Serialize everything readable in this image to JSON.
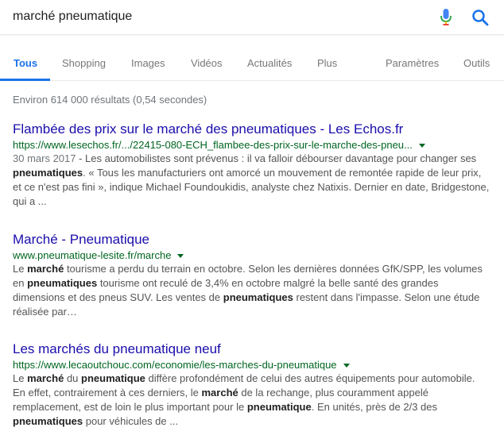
{
  "search": {
    "query": "marché pneumatique",
    "icons": {
      "mic": "mic-icon",
      "search": "search-icon"
    }
  },
  "tabs": [
    {
      "label": "Tous",
      "active": true
    },
    {
      "label": "Shopping"
    },
    {
      "label": "Images"
    },
    {
      "label": "Vidéos"
    },
    {
      "label": "Actualités"
    },
    {
      "label": "Plus"
    },
    {
      "label": "Paramètres"
    },
    {
      "label": "Outils"
    }
  ],
  "stats": "Environ 614 000 résultats (0,54 secondes)",
  "results": [
    {
      "title": "Flambée des prix sur le marché des pneumatiques - Les Echos.fr",
      "url": "https://www.lesechos.fr/.../22415-080-ECH_flambee-des-prix-sur-le-marche-des-pneu...",
      "date": "30 mars 2017",
      "snippet_lines": [
        [
          {
            "t": " - Les automobilistes sont prévenus : il va falloir débourser davantage pour changer ses"
          }
        ],
        [
          {
            "t": "pneumatiques",
            "b": true
          },
          {
            "t": ". « Tous les manufacturiers ont amorcé un mouvement de remontée rapide de leur prix,"
          }
        ],
        [
          {
            "t": "et ce n'est pas fini », indique Michael Foundoukidis, analyste chez Natixis. Dernier en date, Bridgestone,"
          }
        ],
        [
          {
            "t": "qui a ..."
          }
        ]
      ]
    },
    {
      "title": "Marché - Pneumatique",
      "url": "www.pneumatique-lesite.fr/marche",
      "snippet_lines": [
        [
          {
            "t": "Le "
          },
          {
            "t": "marché",
            "b": true
          },
          {
            "t": " tourisme a perdu du terrain en octobre. Selon les dernières données GfK/SPP, les volumes"
          }
        ],
        [
          {
            "t": "en "
          },
          {
            "t": "pneumatiques",
            "b": true
          },
          {
            "t": " tourisme ont reculé de 3,4% en octobre malgré la belle santé des grandes"
          }
        ],
        [
          {
            "t": "dimensions et des pneus SUV. Les ventes de "
          },
          {
            "t": "pneumatiques",
            "b": true
          },
          {
            "t": " restent dans l'impasse. Selon une étude"
          }
        ],
        [
          {
            "t": "réalisée par…"
          }
        ]
      ]
    },
    {
      "title": "Les marchés du pneumatique neuf",
      "url": "https://www.lecaoutchouc.com/economie/les-marches-du-pneumatique",
      "snippet_lines": [
        [
          {
            "t": "Le "
          },
          {
            "t": "marché",
            "b": true
          },
          {
            "t": " du "
          },
          {
            "t": "pneumatique",
            "b": true
          },
          {
            "t": " diffère profondément de celui des autres équipements pour automobile."
          }
        ],
        [
          {
            "t": "En effet, contrairement à ces derniers, le "
          },
          {
            "t": "marché",
            "b": true
          },
          {
            "t": " de la rechange, plus couramment appelé"
          }
        ],
        [
          {
            "t": "remplacement, est de loin le plus important pour le "
          },
          {
            "t": "pneumatique",
            "b": true
          },
          {
            "t": ". En unités, près de 2/3 des"
          }
        ],
        [
          {
            "t": "pneumatiques",
            "b": true
          },
          {
            "t": " pour véhicules de ..."
          }
        ]
      ]
    }
  ],
  "colors": {
    "accent": "#1a73e8",
    "link": "#1a0dab",
    "url": "#006621",
    "mic_blue": "#4285f4",
    "mic_red": "#ea4335",
    "mic_yellow": "#fbbc05",
    "mic_green": "#34a853"
  }
}
